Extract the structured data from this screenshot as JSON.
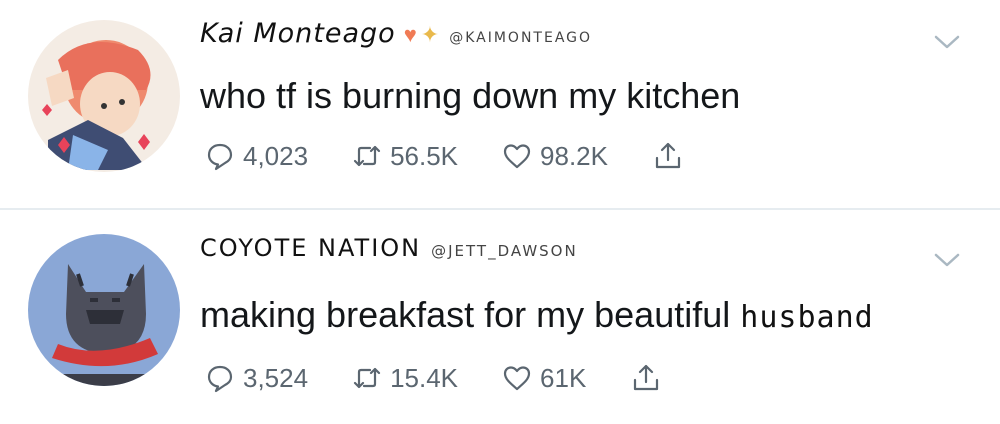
{
  "tweets": [
    {
      "display_name": "Kai Monteago",
      "handle": "@KAIMONTEAGO",
      "emoji_heart": "♥",
      "emoji_sparkle": "✦",
      "text": "who tf is burning down my kitchen",
      "replies": "4,023",
      "retweets": "56.5K",
      "likes": "98.2K"
    },
    {
      "display_name": "COYOTE NATION",
      "handle": "@JETT_DAWSON",
      "text": "making breakfast for my beautiful",
      "text_handwritten": "husband",
      "replies": "3,524",
      "retweets": "15.4K",
      "likes": "61K"
    }
  ]
}
